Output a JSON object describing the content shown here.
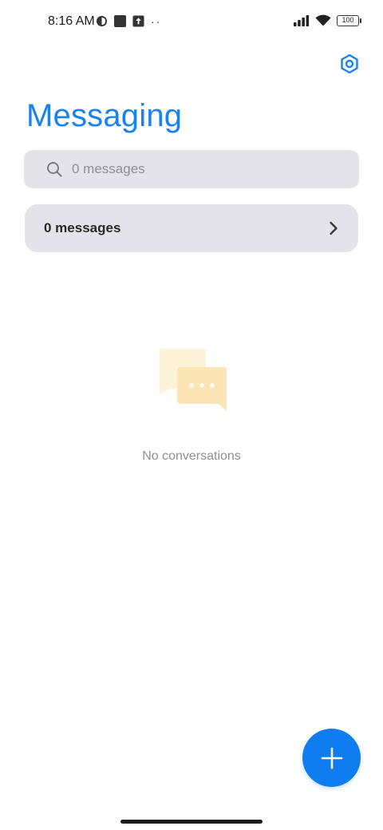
{
  "status_bar": {
    "time": "8:16 AM",
    "battery": "100",
    "left_icons": [
      "app-notification-icon",
      "square-notification-icon",
      "upload-notification-icon",
      "more-dots-icon"
    ],
    "right_icons": [
      "signal-icon",
      "wifi-icon",
      "battery-icon"
    ]
  },
  "header": {
    "title": "Messaging",
    "settings_icon": "settings-hexagon-icon"
  },
  "search": {
    "placeholder": "0 messages",
    "icon": "search-icon"
  },
  "messages_row": {
    "label": "0 messages",
    "icon": "chevron-right-icon"
  },
  "empty_state": {
    "text": "No conversations",
    "icon": "chat-bubbles-icon"
  },
  "fab": {
    "icon": "plus-icon"
  },
  "colors": {
    "accent": "#1a82f0",
    "fab": "#0f7df0",
    "surface": "#e3e3e9",
    "muted_text": "#8f8f96",
    "bubble_light": "#fdf3d9",
    "bubble_dark": "#fbe5b6"
  }
}
